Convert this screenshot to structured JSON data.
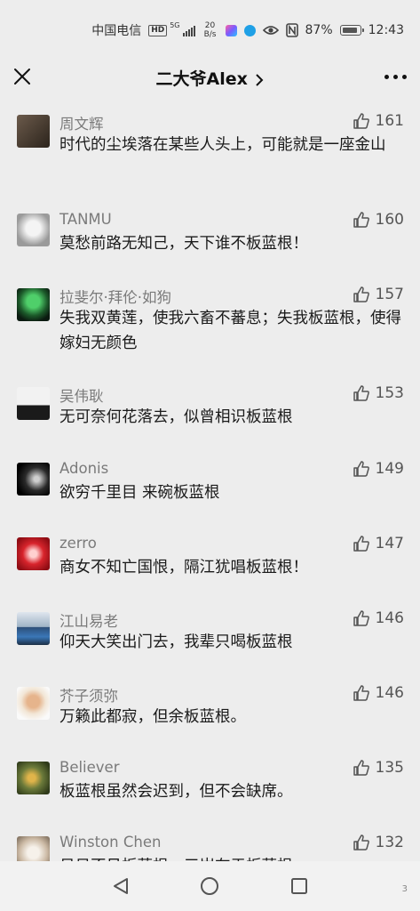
{
  "status_bar": {
    "carrier": "中国电信",
    "hd": "HD",
    "net": "5G",
    "speed_top": "20",
    "speed_bottom": "B/s",
    "battery": "87%",
    "time": "12:43"
  },
  "header": {
    "title": "二大爷Alex"
  },
  "comments": [
    {
      "name": "周文辉",
      "likes": "161",
      "text": "时代的尘埃落在某些人头上，可能就是一座金山"
    },
    {
      "name": "TANMU",
      "likes": "160",
      "text": "莫愁前路无知己，天下谁不板蓝根！"
    },
    {
      "name": "拉斐尔·拜伦·如狗",
      "likes": "157",
      "text": "失我双黄莲，使我六畜不蕃息；失我板蓝根，使得嫁妇无颜色"
    },
    {
      "name": "吴伟耿",
      "likes": "153",
      "text": "无可奈何花落去，似曾相识板蓝根"
    },
    {
      "name": "Adonis",
      "likes": "149",
      "text": "欲穷千里目 来碗板蓝根"
    },
    {
      "name": "zerro",
      "likes": "147",
      "text": "商女不知亡国恨，隔江犹唱板蓝根！"
    },
    {
      "name": "江山易老",
      "likes": "146",
      "text": "仰天大笑出门去，我辈只喝板蓝根"
    },
    {
      "name": "芥子须弥",
      "likes": "146",
      "text": "万籁此都寂，但余板蓝根。"
    },
    {
      "name": "Believer",
      "likes": "135",
      "text": "板蓝根虽然会迟到，但不会缺席。"
    },
    {
      "name": "Winston Chen",
      "likes": "132",
      "text": "日日不见板蓝根，三岁在于板蓝根"
    }
  ],
  "icons": {
    "close": "close-icon",
    "chevron": "chevron-right-icon",
    "more": "more-icon",
    "like": "thumbs-up-icon",
    "back": "back-triangle-icon",
    "home": "home-circle-icon",
    "recent": "recent-square-icon"
  },
  "colors": {
    "background": "#ededed",
    "name_gray": "#7a7a7a",
    "text": "#1a1a1a"
  }
}
